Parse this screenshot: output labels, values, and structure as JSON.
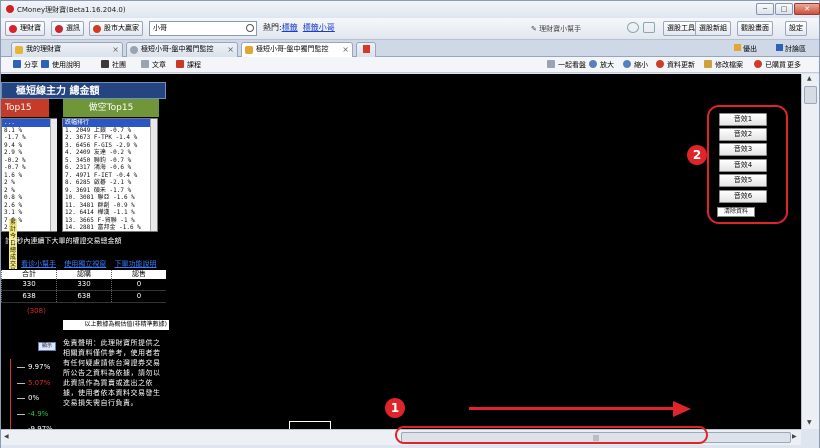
{
  "window": {
    "title": "CMoney理財寶(Beta1.16.204.0)",
    "controls": [
      "─",
      "□",
      "✕"
    ]
  },
  "toolbar": {
    "buttons": [
      {
        "label": "理財寶",
        "icon": "star-icon",
        "color": "#d9232a"
      },
      {
        "label": "選訊",
        "icon": "bell-icon",
        "color": "#c5282e"
      },
      {
        "label": "股市大贏家",
        "icon": "cycle-icon",
        "color": "#d33a1e"
      }
    ],
    "search": {
      "value": "小哥"
    },
    "hot": {
      "label": "熱門:",
      "links": [
        "標籤",
        "標籤小哥"
      ]
    },
    "right_buttons": [
      "選股工具",
      "選股新組",
      "觀股畫面",
      "設定"
    ],
    "right_icons_text": "✎ 理財寶小幫手"
  },
  "tabs": [
    {
      "label": "我的理財寶",
      "icon_color": "#e6b43a",
      "active": false
    },
    {
      "label": "極短小哥-盤中獨門監控",
      "icon_color": "#9aa3b2",
      "active": false
    },
    {
      "label": "極短小哥-盤中獨門監控",
      "icon_color": "#e3a634",
      "active": true
    }
  ],
  "tabs_right": [
    "優出",
    "討論區"
  ],
  "toolbar2": {
    "left": [
      {
        "label": "分享",
        "color": "#2d62b8"
      },
      {
        "label": "使用說明",
        "color": "#2d62b8"
      },
      {
        "label": "社團",
        "color": "#3a3a3a"
      },
      {
        "label": "文章",
        "color": "#9aa3b2"
      },
      {
        "label": "課程",
        "color": "#c93a2a"
      }
    ],
    "right": [
      {
        "label": "一起看盤",
        "color": "#9aa3b2"
      },
      {
        "label": "放大",
        "color": "#5a7fbf"
      },
      {
        "label": "縮小",
        "color": "#5a7fbf"
      },
      {
        "label": "資料更新",
        "color": "#d03a2a"
      },
      {
        "label": "修改檔案",
        "color": "#c9a23a"
      },
      {
        "label": "已購買",
        "color": "#d03a2a"
      },
      {
        "label": "更多"
      }
    ]
  },
  "panel": {
    "title": "極短線主力 總金額",
    "buy_header": "Top15",
    "sell_header": "做空Top15",
    "left_rows": [
      "...",
      "8.1 %",
      "-1.7 %",
      "9.4 %",
      "2.9 %",
      "-0.2 %",
      "-0.7 %",
      "1.6 %",
      "2 %",
      "2 %",
      "0.8 %",
      "2.6 %",
      "3.1 %",
      "7.6 %",
      "2 %",
      "3.2 %"
    ],
    "sell_rows": [
      "1.  2049 上銀 -0.7 %",
      "2.  3673 F-TPK -1.4 %",
      "3.  6456 F-GIS -2.9 %",
      "4.  2409 友達 -0.2 %",
      "5.  3450 聯鈞 -0.7 %",
      "6.  2317 鴻海 -0.6 %",
      "7.  4971 F-IET -0.4 %",
      "8.  6285 啟碁 -2.1 %",
      "9.  3691 碩禾 -1.7 %",
      "10. 3081 聯亞 -1.6 %",
      "11. 3481 群創 -0.9 %",
      "12. 6414 樺漢 -1.1 %",
      "13. 3665 F-貿聯 -1 %",
      "14. 2881 富邦金 -1.6 %"
    ],
    "vertical_label": "累計今日總成交量",
    "info_text": "計2秒內連續下大單的權證交易總金額",
    "links": [
      "看诊小幫手",
      "使用獨立視窗",
      "下單功能說明"
    ],
    "grid_headers": [
      "合計",
      "認購",
      "認售"
    ],
    "grid_rows": [
      [
        "330",
        "330",
        "0"
      ],
      [
        "638",
        "638",
        "0"
      ]
    ],
    "red_small": "(308)",
    "footer": "以上數據為概估值(非精準數據)",
    "mini_btn": "顯示",
    "mini_pcts": [
      {
        "v": "9.97%",
        "color": "#ffffff"
      },
      {
        "v": "5.07%",
        "color": "#e0302a"
      },
      {
        "v": "0%",
        "color": "#ffffff"
      },
      {
        "v": "-4.9%",
        "color": "#25c23a"
      },
      {
        "v": "-9.97%",
        "color": "#ffffff"
      }
    ],
    "disclaimer": "免責聲明：此理財寶所提供之相關資料僅供參考，使用者若有任何疑慮請依台灣證券交易所公告之資料為依據，請勿以此資訊作為買賣或進出之依據，使用者依本資料交易發生交易損失需自行負責。"
  },
  "sound_buttons": [
    "音效1",
    "音效2",
    "音效3",
    "音效4",
    "音效5",
    "音效6"
  ],
  "clear_button": "清除資料",
  "annotations": {
    "badge1": "1",
    "badge2": "2",
    "accent": "#e0252a"
  }
}
